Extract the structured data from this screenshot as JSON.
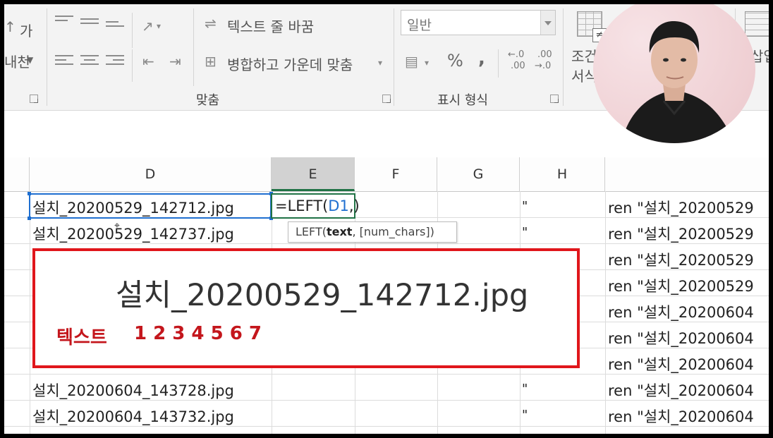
{
  "ribbon": {
    "font_top": "가",
    "font_bottom": "내천",
    "wrap_text": "텍스트 줄 바꿈",
    "merge_center": "병합하고 가운데 맞춤",
    "alignment_group": "맞춤",
    "number_format": "일반",
    "percent": "%",
    "comma": ",",
    "dec_increase_top": "←.0",
    "dec_increase_bottom": ".00",
    "dec_decrease_top": ".00",
    "dec_decrease_bottom": "→.0",
    "number_group": "표시 형식",
    "cond_format_line1": "조건",
    "cond_format_line2": "서식",
    "insert": "삽입"
  },
  "columns": [
    "D",
    "E",
    "F",
    "G",
    "H"
  ],
  "selected_column": "E",
  "rows": [
    {
      "d": "설치_20200529_142712.jpg",
      "h": "\"",
      "i": "ren \"설치_20200529"
    },
    {
      "d": "설치_20200529_142737.jpg",
      "h": "\"",
      "i": "ren \"설치_20200529"
    },
    {
      "d": "",
      "h": "",
      "i": "ren \"설치_20200529"
    },
    {
      "d": "",
      "h": "",
      "i": "ren \"설치_20200529"
    },
    {
      "d": "",
      "h": "",
      "i": "ren \"설치_20200604"
    },
    {
      "d": "",
      "h": "",
      "i": "ren \"설치_20200604"
    },
    {
      "d": "",
      "h": "",
      "i": "ren \"설치_20200604"
    },
    {
      "d": "설치_20200604_143728.jpg",
      "h": "\"",
      "i": "ren \"설치_20200604"
    },
    {
      "d": "설치_20200604_143732.jpg",
      "h": "\"",
      "i": "ren \"설치_20200604"
    }
  ],
  "formula": {
    "prefix": "=LEFT(",
    "ref": "D1",
    "suffix": ",)"
  },
  "tooltip": {
    "fn": "LEFT(",
    "arg": "text",
    "rest": ", [num_chars])"
  },
  "callout": {
    "filename": "설치_20200529_142712.jpg",
    "label": "텍스트",
    "numbers": "1  2  3 4 5 6 7"
  },
  "colors": {
    "selection": "#1f6fd0",
    "active_cell": "#217346",
    "callout": "#e0161b",
    "callout_text": "#c4161c"
  }
}
